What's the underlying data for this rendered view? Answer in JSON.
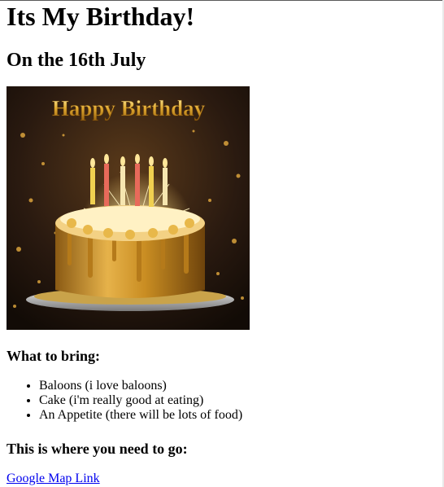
{
  "page": {
    "title": "Its My Birthday!",
    "subtitle": "On the 16th July"
  },
  "image": {
    "banner_text": "Happy Birthday",
    "subject": "golden birthday cake with lit candles and sparklers"
  },
  "bring": {
    "heading": "What to bring:",
    "items": [
      "Baloons (i love baloons)",
      "Cake (i'm really good at eating)",
      "An Appetite (there will be lots of food)"
    ]
  },
  "directions": {
    "heading": "This is where you need to go:",
    "link_text": "Google Map Link"
  },
  "colors": {
    "link": "#0000ee",
    "gold": "#d9a43a",
    "background_dark": "#2a1a10"
  }
}
